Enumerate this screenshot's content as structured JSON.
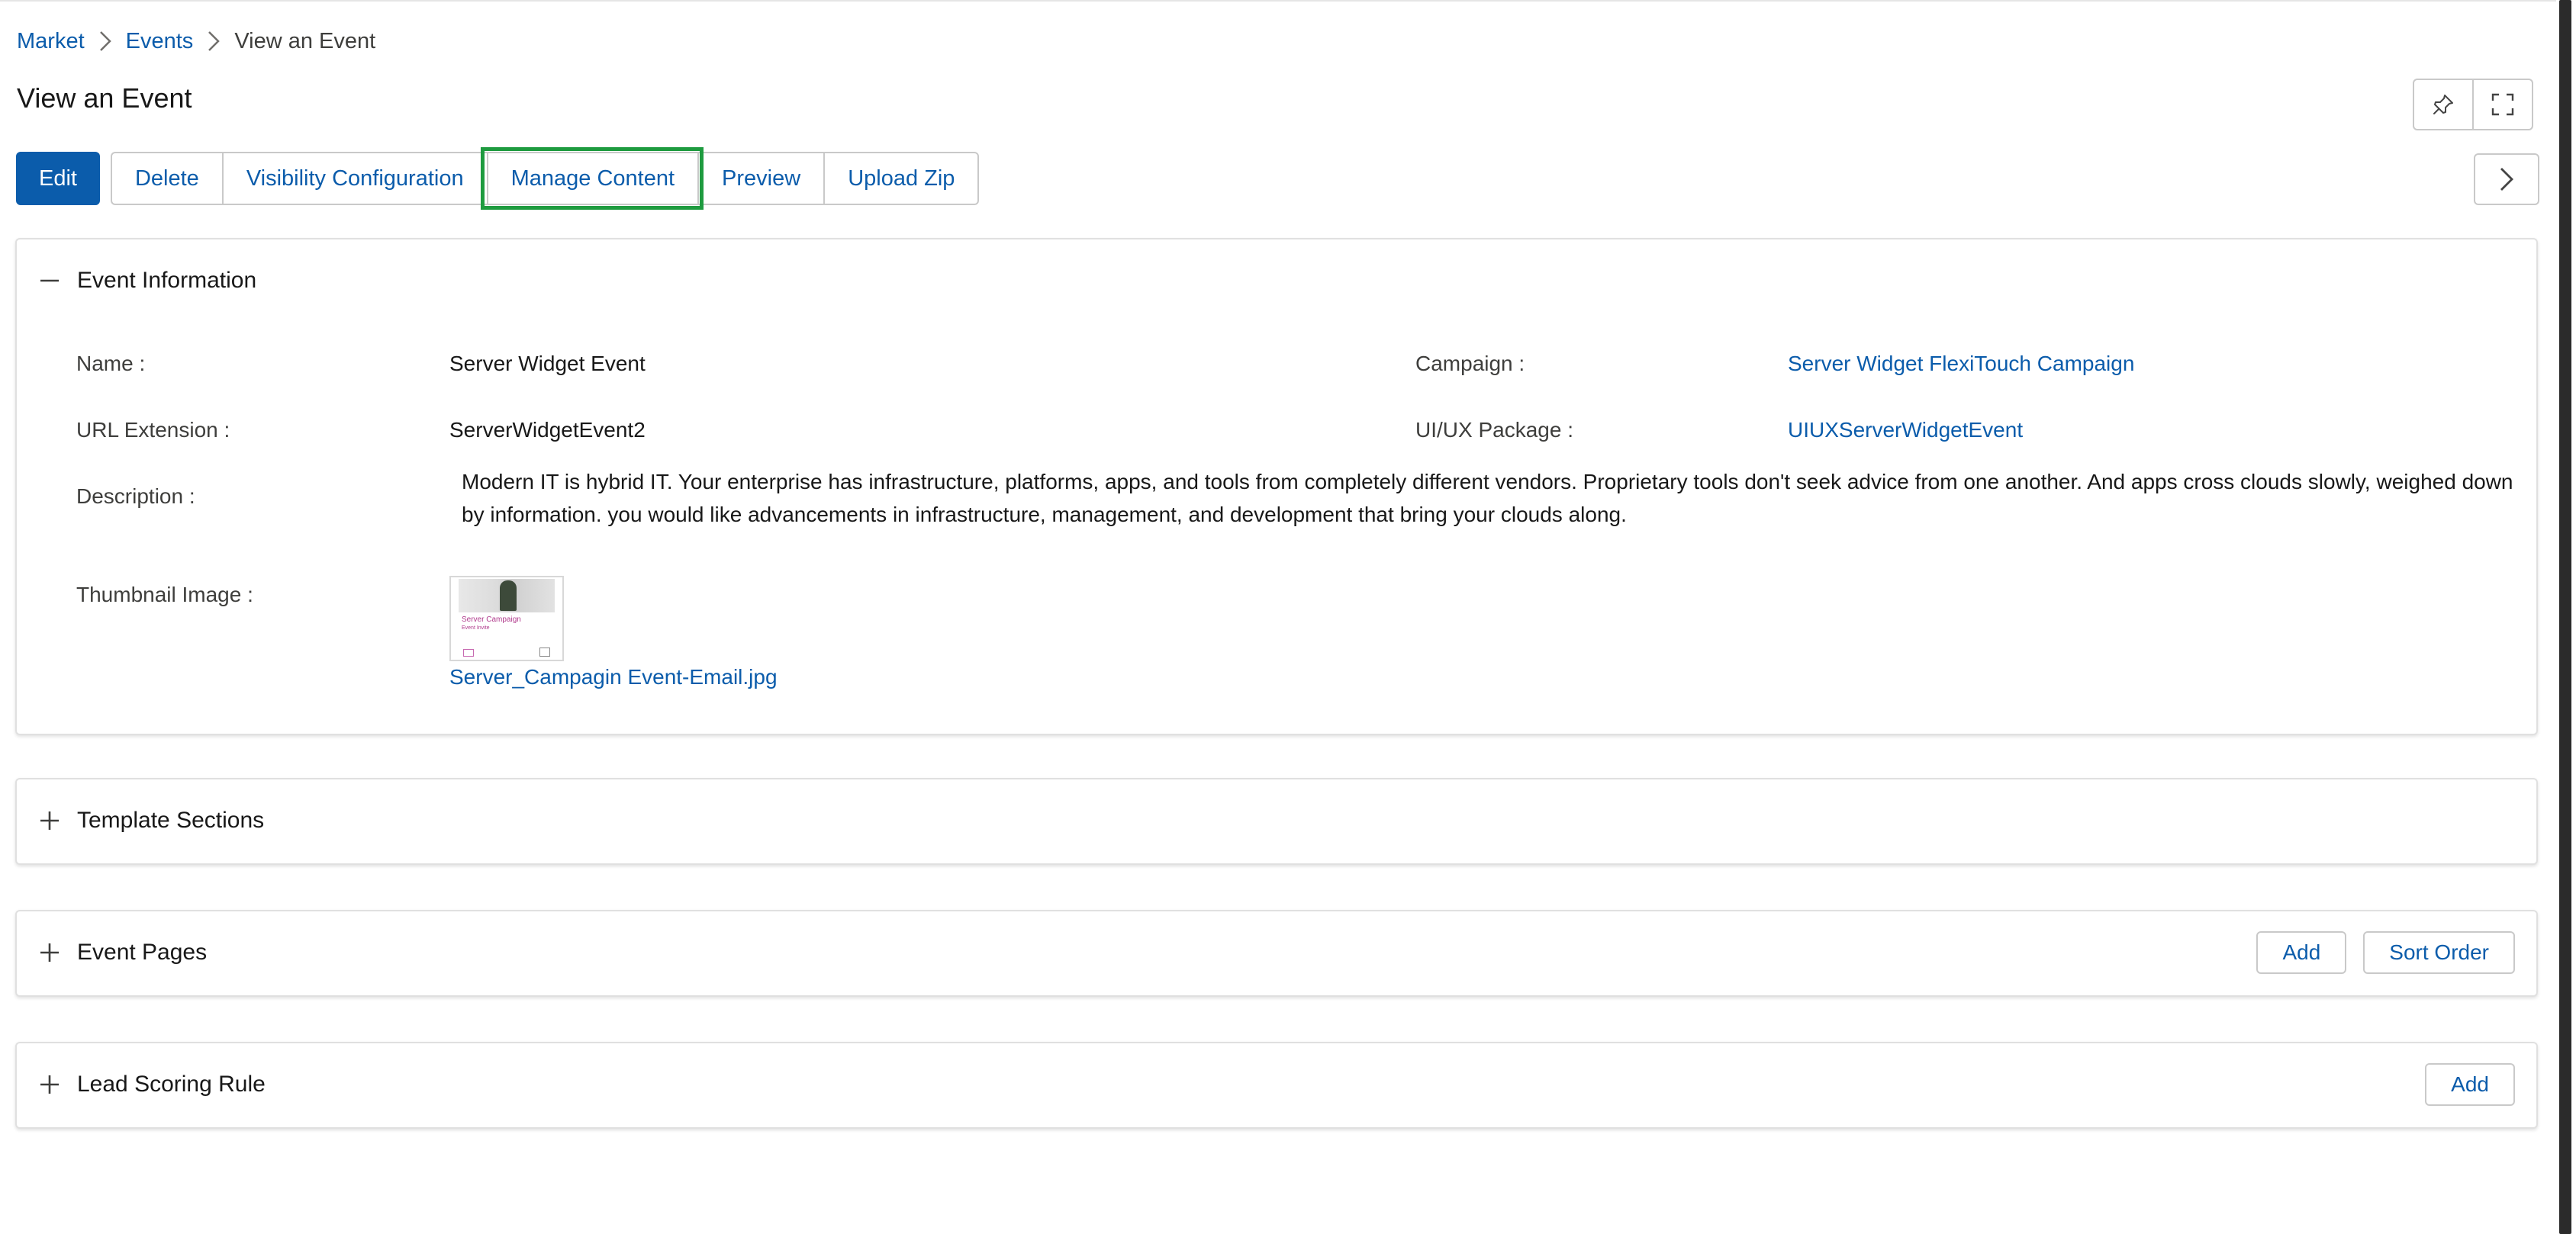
{
  "breadcrumb": {
    "items": [
      {
        "label": "Market"
      },
      {
        "label": "Events"
      },
      {
        "label": "View an Event"
      }
    ]
  },
  "page": {
    "title": "View an Event"
  },
  "toolbar": {
    "edit_label": "Edit",
    "delete_label": "Delete",
    "visibility_label": "Visibility Configuration",
    "manage_content_label": "Manage Content",
    "preview_label": "Preview",
    "upload_zip_label": "Upload Zip"
  },
  "icons": {
    "pin": "pin-icon",
    "expand": "expand-icon",
    "next": "chevron-right-icon"
  },
  "event_information": {
    "title": "Event Information",
    "name_label": "Name :",
    "name_value": "Server Widget Event",
    "campaign_label": "Campaign :",
    "campaign_value": "Server Widget FlexiTouch Campaign",
    "url_label": "URL Extension :",
    "url_value": "ServerWidgetEvent2",
    "package_label": "UI/UX Package :",
    "package_value": "UIUXServerWidgetEvent",
    "description_label": "Description :",
    "description_value": "Modern IT is hybrid IT. Your enterprise has infrastructure, platforms, apps, and tools from completely different vendors. Proprietary tools don't seek advice from one another. And apps cross clouds slowly, weighed down by information. you would like advancements in infrastructure, management, and development that bring your clouds along.",
    "thumbnail_label": "Thumbnail Image :",
    "thumbnail_file": "Server_Campagin Event-Email.jpg",
    "thumbnail_caption": "Server Campaign",
    "thumbnail_subcaption": "Event Invite"
  },
  "template_sections": {
    "title": "Template Sections"
  },
  "event_pages": {
    "title": "Event Pages",
    "add_label": "Add",
    "sort_label": "Sort Order"
  },
  "lead_scoring": {
    "title": "Lead Scoring Rule",
    "add_label": "Add"
  },
  "colors": {
    "brand": "#0b5cab",
    "highlight": "#1e9b3f",
    "border": "#c9c9c9"
  }
}
